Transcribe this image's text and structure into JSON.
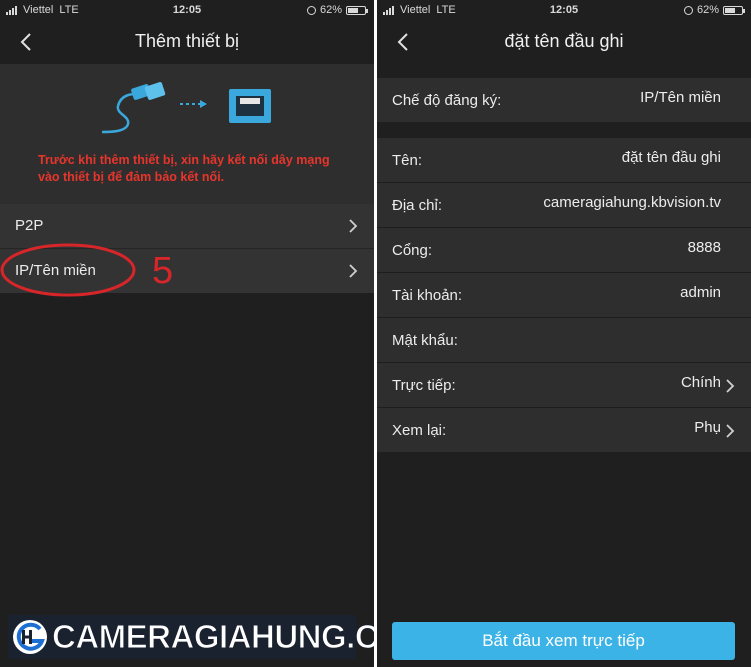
{
  "status_left": {
    "carrier": "Viettel",
    "network": "LTE",
    "time": "12:05",
    "battery": "62%",
    "battery_level": 0.62
  },
  "status_right": {
    "carrier": "Viettel",
    "network": "LTE",
    "time": "12:05",
    "battery": "62%",
    "battery_level": 0.62
  },
  "left_screen": {
    "title": "Thêm thiết bị",
    "warning": "Trước khi thêm thiết bị, xin hãy kết nối dây mạng vào thiết bị để đảm bảo kết nối.",
    "options": [
      {
        "label": "P2P"
      },
      {
        "label": "IP/Tên miền"
      }
    ],
    "annotation_number": "5",
    "watermark": "CAMERAGIAHUNG.COM"
  },
  "right_screen": {
    "title": "đặt tên đầu ghi",
    "registration": {
      "label": "Chế độ đăng ký:",
      "value": "IP/Tên miền"
    },
    "fields": [
      {
        "label": "Tên:",
        "value": "đặt tên đầu ghi"
      },
      {
        "label": "Địa chỉ:",
        "value": "cameragiahung.kbvision.tv"
      },
      {
        "label": "Cổng:",
        "value": "8888"
      },
      {
        "label": "Tài khoản:",
        "value": "admin"
      },
      {
        "label": "Mật khẩu:",
        "value": ""
      },
      {
        "label": "Trực tiếp:",
        "value": "Chính"
      },
      {
        "label": "Xem lại:",
        "value": "Phụ"
      }
    ],
    "start_button": "Bắt đầu xem trực tiếp"
  },
  "colors": {
    "background": "#1f1f1f",
    "row": "#333333",
    "warning": "#e8352c",
    "annotation": "#d6262a",
    "accent": "#3cb3e6"
  },
  "icons": [
    "back-arrow-icon",
    "chevron-right-icon",
    "ethernet-cable-icon",
    "ethernet-port-icon",
    "signal-icon",
    "battery-icon",
    "rotation-lock-icon"
  ]
}
